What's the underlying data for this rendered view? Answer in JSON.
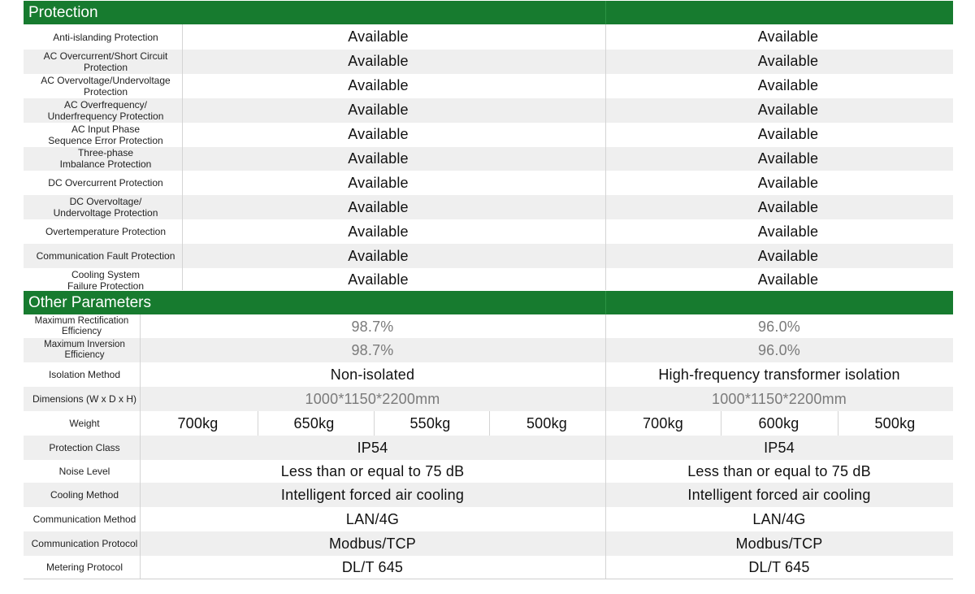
{
  "protection": {
    "title": "Protection",
    "rows": [
      {
        "label": "Anti-islanding Protection",
        "col1": "Available",
        "col2": "Available"
      },
      {
        "label": "AC Overcurrent/Short Circuit\nProtection",
        "col1": "Available",
        "col2": "Available"
      },
      {
        "label": "AC Overvoltage/Undervoltage\nProtection",
        "col1": "Available",
        "col2": "Available"
      },
      {
        "label": "AC Overfrequency/\nUnderfrequency Protection",
        "col1": "Available",
        "col2": "Available"
      },
      {
        "label": "AC Input Phase\nSequence Error Protection",
        "col1": "Available",
        "col2": "Available"
      },
      {
        "label": "Three-phase\nImbalance Protection",
        "col1": "Available",
        "col2": "Available"
      },
      {
        "label": "DC Overcurrent Protection",
        "col1": "Available",
        "col2": "Available"
      },
      {
        "label": "DC Overvoltage/\nUndervoltage Protection",
        "col1": "Available",
        "col2": "Available"
      },
      {
        "label": "Overtemperature Protection",
        "col1": "Available",
        "col2": "Available"
      },
      {
        "label": "Communication Fault Protection",
        "col1": "Available",
        "col2": "Available"
      },
      {
        "label": "Cooling System\nFailure Protection",
        "col1": "Available",
        "col2": "Available"
      }
    ]
  },
  "other": {
    "title": "Other Parameters",
    "max_rect": {
      "label": "Maximum Rectification\nEfficiency",
      "col1": "98.7%",
      "col2": "96.0%"
    },
    "max_inv": {
      "label": "Maximum Inversion\nEfficiency",
      "col1": "98.7%",
      "col2": "96.0%"
    },
    "isolation": {
      "label": "Isolation Method",
      "col1": "Non-isolated",
      "col2": "High-frequency transformer isolation"
    },
    "dimensions": {
      "label": "Dimensions (W x D x H)",
      "col1": "1000*1150*2200mm",
      "col2": "1000*1150*2200mm"
    },
    "weight": {
      "label": "Weight",
      "col1": [
        "700kg",
        "650kg",
        "550kg",
        "500kg"
      ],
      "col2": [
        "700kg",
        "600kg",
        "500kg"
      ]
    },
    "protection_class": {
      "label": "Protection Class",
      "col1": "IP54",
      "col2": "IP54"
    },
    "noise": {
      "label": "Noise Level",
      "col1": "Less than or equal to 75 dB",
      "col2": "Less than or equal to 75 dB"
    },
    "cooling": {
      "label": "Cooling Method",
      "col1": "Intelligent forced air cooling",
      "col2": "Intelligent forced air cooling"
    },
    "comm_method": {
      "label": "Communication Method",
      "col1": "LAN/4G",
      "col2": "LAN/4G"
    },
    "comm_protocol": {
      "label": "Communication Protocol",
      "col1": "Modbus/TCP",
      "col2": "Modbus/TCP"
    },
    "metering": {
      "label": "Metering Protocol",
      "col1": "DL/T 645",
      "col2": "DL/T 645"
    }
  },
  "colors": {
    "header_green": "#177b2f",
    "alt_row": "#efefef",
    "divider": "#d4d4d4"
  }
}
